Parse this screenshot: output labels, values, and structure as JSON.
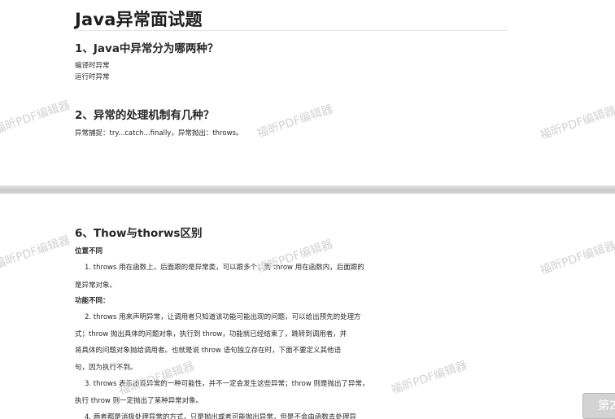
{
  "page1": {
    "title": "Java异常面试题",
    "q1": {
      "heading": "1、Java中异常分为哪两种？",
      "lines": [
        "编译时异常",
        "运行时异常"
      ]
    },
    "q2": {
      "heading": "2、异常的处理机制有几种？",
      "lines": [
        "异常捕捉：try...catch...finally，异常抛出：throws。"
      ]
    }
  },
  "page2": {
    "q6": {
      "heading": "6、Thow与thorws区别",
      "sub1": "位置不同",
      "p1": [
        "1. throws 用在函数上，后面跟的是异常类，可以跟多个；而 throw 用在函数内，后面跟的",
        "是异常对象。"
      ],
      "sub2": "功能不同：",
      "p2": [
        "2. throws 用来声明异常，让调用者只知道该功能可能出现的问题，可以给出预先的处理方",
        "式；throw 抛出具体的问题对象，执行到 throw，功能就已经结束了，跳转到调用者，并",
        "将具体的问题对象抛给调用者。也就是说 throw 语句独立存在时，下面不要定义其他语",
        "句，因为执行不到。"
      ],
      "p3": [
        "3. throws 表示出现异常的一种可能性，并不一定会发生这些异常；throw 则是抛出了异常，",
        "执行 throw 则一定抛出了某种异常对象。"
      ],
      "p4": [
        "4. 两者都是消极处理异常的方式，只是抛出或者可能抛出异常，但是不会由函数去处理异"
      ]
    }
  },
  "watermark": "福昕PDF编辑器",
  "nav": {
    "page_button": "第2"
  }
}
